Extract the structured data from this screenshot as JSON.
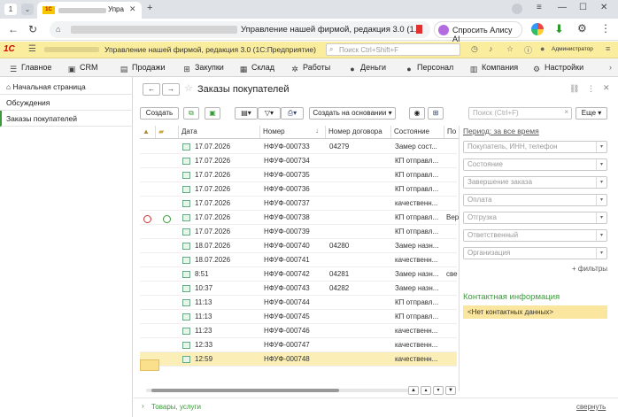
{
  "browser": {
    "tab_number": "1",
    "tab_title_visible": "Упра",
    "address_title": "Управление нашей фирмой, редакция 3.0 (1...",
    "alice_label": "Спросить Алису AI"
  },
  "app_header": {
    "logo": "1С",
    "title": "Управление нашей фирмой, редакция 3.0 (1С:Предприятие)",
    "search_placeholder": "Поиск Ctrl+Shift+F",
    "user": "Администратор"
  },
  "sections": [
    "Главное",
    "CRM",
    "Продажи",
    "Закупки",
    "Склад",
    "Работы",
    "Деньги",
    "Персонал",
    "Компания",
    "Настройки"
  ],
  "left_panel": [
    "Начальная страница",
    "Обсуждения",
    "Заказы покупателей"
  ],
  "form": {
    "title": "Заказы покупателей",
    "create_label": "Создать",
    "create_based_on_label": "Создать на основании",
    "search_placeholder": "Поиск (Ctrl+F)",
    "more_label": "Еще",
    "period_label": "Период: за все время",
    "filters": [
      "Покупатель, ИНН, телефон",
      "Состояние",
      "Завершение заказа",
      "Оплата",
      "Отгрузка",
      "Ответственный",
      "Организация"
    ],
    "add_filters_label": "+ фильтры",
    "contact_title": "Контактная информация",
    "contact_empty": "<Нет контактных данных>",
    "goods_link": "Товары, услуги",
    "collapse_link": "свернуть"
  },
  "table": {
    "columns": [
      "Дата",
      "Номер",
      "Номер договора",
      "Состояние",
      "По"
    ],
    "rows": [
      {
        "date": "17.07.2026",
        "num": "НФУФ-000733",
        "contract": "04279",
        "state": "Замер сост...",
        "extra": ""
      },
      {
        "date": "17.07.2026",
        "num": "НФУФ-000734",
        "contract": "",
        "state": "КП отправл...",
        "extra": ""
      },
      {
        "date": "17.07.2026",
        "num": "НФУФ-000735",
        "contract": "",
        "state": "КП отправл...",
        "extra": ""
      },
      {
        "date": "17.07.2026",
        "num": "НФУФ-000736",
        "contract": "",
        "state": "КП отправл...",
        "extra": ""
      },
      {
        "date": "17.07.2026",
        "num": "НФУФ-000737",
        "contract": "",
        "state": "качественн...",
        "extra": ""
      },
      {
        "date": "17.07.2026",
        "num": "НФУФ-000738",
        "contract": "",
        "state": "КП отправл...",
        "extra": "Вер"
      },
      {
        "date": "17.07.2026",
        "num": "НФУФ-000739",
        "contract": "",
        "state": "КП отправл...",
        "extra": ""
      },
      {
        "date": "18.07.2026",
        "num": "НФУФ-000740",
        "contract": "04280",
        "state": "Замер назн...",
        "extra": ""
      },
      {
        "date": "18.07.2026",
        "num": "НФУФ-000741",
        "contract": "",
        "state": "качественн...",
        "extra": ""
      },
      {
        "date": "8:51",
        "num": "НФУФ-000742",
        "contract": "04281",
        "state": "Замер назн...",
        "extra": "све"
      },
      {
        "date": "10:37",
        "num": "НФУФ-000743",
        "contract": "04282",
        "state": "Замер назн...",
        "extra": ""
      },
      {
        "date": "11:13",
        "num": "НФУФ-000744",
        "contract": "",
        "state": "КП отправл...",
        "extra": ""
      },
      {
        "date": "11:13",
        "num": "НФУФ-000745",
        "contract": "",
        "state": "КП отправл...",
        "extra": ""
      },
      {
        "date": "11:23",
        "num": "НФУФ-000746",
        "contract": "",
        "state": "качественн...",
        "extra": ""
      },
      {
        "date": "12:33",
        "num": "НФУФ-000747",
        "contract": "",
        "state": "качественн...",
        "extra": ""
      },
      {
        "date": "12:59",
        "num": "НФУФ-000748",
        "contract": "",
        "state": "качественн...",
        "extra": ""
      }
    ]
  }
}
